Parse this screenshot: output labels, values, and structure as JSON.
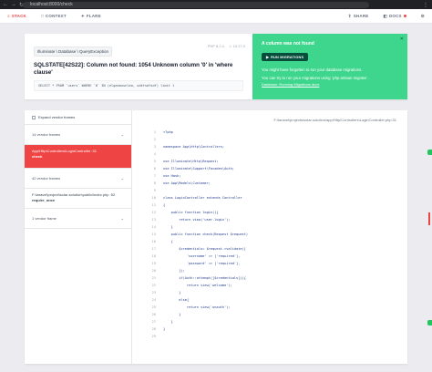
{
  "browser": {
    "url": "localhost:8000/check"
  },
  "topnav": {
    "tabs": [
      {
        "label": "STACK",
        "icon": "stack-icon"
      },
      {
        "label": "CONTEXT",
        "icon": "context-icon"
      },
      {
        "label": "FLARE",
        "icon": "flare-icon"
      }
    ],
    "share_label": "SHARE",
    "docs_label": "DOCS"
  },
  "exception": {
    "class": "Illuminate \\ Database \\ QueryException",
    "php_version": "PHP 8.2.4",
    "laravel_version": "10.27.0",
    "title": "SQLSTATE[42S22]: Column not found: 1054 Unknown column '0' in 'where clause'",
    "sql": "SELECT * FROM `users` WHERE `0` IN (elgasmusnlea, sdkfsdfsdf) limit 1"
  },
  "solution": {
    "title": "A column was not found",
    "run_button": "RUN MIGRATIONS",
    "text1": "You might have forgotten to run your database migrations.",
    "text2": "You can try to run your migrations using `php artisan migrate`.",
    "link": "Database: Running Migrations docs"
  },
  "frames": {
    "expand_label": "Expand vendor frames",
    "vendor1": {
      "label": "14 vendor frames"
    },
    "app_frame": {
      "path": "App\\Http\\Controllers\\LoginController",
      "method": "check",
      "line": "31"
    },
    "vendor2": {
      "label": "42 vendor frames"
    },
    "public_frame": {
      "path": "F:\\laravel\\project\\solar-solution\\public\\index.php",
      "method": "require_once",
      "line": "52"
    },
    "vendor3": {
      "label": "1 vendor frame"
    }
  },
  "code": {
    "file_path": "F:\\laravel\\projects\\solar-solution\\app\\Http\\Controllers\\LoginController.php:31",
    "highlight_line": 31,
    "lines": [
      {
        "n": "1",
        "t": "<?php"
      },
      {
        "n": "2",
        "t": ""
      },
      {
        "n": "3",
        "t": "namespace App\\Http\\Controllers;"
      },
      {
        "n": "4",
        "t": ""
      },
      {
        "n": "5",
        "t": "use Illuminate\\Http\\Request;"
      },
      {
        "n": "6",
        "t": "use Illuminate\\Support\\Facades\\Auth;"
      },
      {
        "n": "7",
        "t": "use Hash;"
      },
      {
        "n": "8",
        "t": "use App\\Models\\Customer;"
      },
      {
        "n": "9",
        "t": ""
      },
      {
        "n": "10",
        "t": "class LoginController extends Controller"
      },
      {
        "n": "11",
        "t": "{"
      },
      {
        "n": "12",
        "t": "    public function login(){"
      },
      {
        "n": "13",
        "t": "        return view('user.login');"
      },
      {
        "n": "14",
        "t": "    }"
      },
      {
        "n": "15",
        "t": "    public function check(Request $request)"
      },
      {
        "n": "16",
        "t": "    {"
      },
      {
        "n": "17",
        "t": "        $credentials= $request->validate(["
      },
      {
        "n": "18",
        "t": "            'username' => ['required'],"
      },
      {
        "n": "19",
        "t": "            'password' => ['required'],"
      },
      {
        "n": "20",
        "t": "        ]);"
      },
      {
        "n": "21",
        "t": "        if(Auth::attempt([$credentials])){"
      },
      {
        "n": "22",
        "t": "            return view('welcome');"
      },
      {
        "n": "23",
        "t": "        }"
      },
      {
        "n": "24",
        "t": "        else{"
      },
      {
        "n": "25",
        "t": "            return view('unauth');"
      },
      {
        "n": "26",
        "t": "        }"
      },
      {
        "n": "27",
        "t": "    }"
      },
      {
        "n": "28",
        "t": "}"
      },
      {
        "n": "29",
        "t": ""
      }
    ]
  },
  "colors": {
    "error": "#ef4444",
    "solution_bg": "#3dd68c",
    "solution_button": "#064e3b"
  }
}
